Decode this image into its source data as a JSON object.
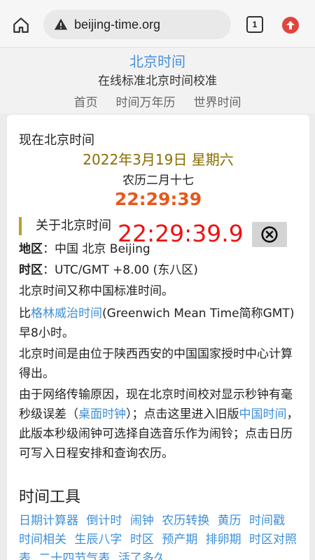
{
  "browser": {
    "url": "beijing-time.org",
    "tab_count": "1"
  },
  "header": {
    "title": "北京时间",
    "subtitle": "在线标准北京时间校准",
    "nav": [
      "首页",
      "时间万年历",
      "世界时间"
    ]
  },
  "clock": {
    "label": "现在北京时间",
    "date": "2022年3月19日 星期六",
    "lunar": "农历二月十七",
    "time": "22:29:39",
    "precise_time": "22:29:39.9"
  },
  "about": {
    "heading": "关于北京时间",
    "region_label": "地区",
    "region_value": "：中国 北京 Beijing",
    "zone_label": "时区",
    "zone_value": "：UTC/GMT +8.00 (东八区)",
    "p1": "北京时间又称中国标准时间。",
    "p2_pre": "比",
    "p2_link": "格林威治时间",
    "p2_post": "(Greenwich Mean Time简称GMT)早8小时。",
    "p3": "北京时间是由位于陕西西安的中国国家授时中心计算得出。",
    "p4_a": "由于网络传输原因，现在北京时间校对显示秒钟有毫秒级误差（",
    "p4_link1": "桌面时钟",
    "p4_b": "）；点击这里进入旧版",
    "p4_link2": "中国时间",
    "p4_c": "，此版本秒级闹钟可选择自选音乐作为闹铃；点击日历可写入日程安排和查询农历。"
  },
  "tools": {
    "heading": "时间工具",
    "items": [
      "日期计算器",
      "倒计时",
      "闹钟",
      "农历转换",
      "黄历",
      "时间戳",
      "时间相关",
      "生辰八字",
      "时区",
      "预产期",
      "排卵期",
      "时区对照表",
      "二十四节气表",
      "活了多久"
    ]
  },
  "colors": {
    "accent": "#4a90d9",
    "date": "#8a6d00",
    "time": "#e8581c",
    "precise": "#ee1111"
  }
}
